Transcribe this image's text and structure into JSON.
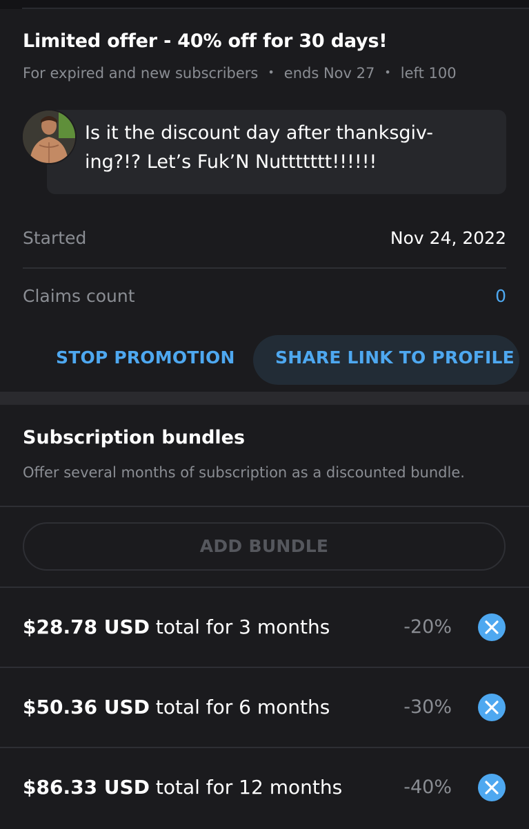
{
  "promotion": {
    "title": "Limited offer - 40% off for 30 days!",
    "audience": "For expired and new subscribers",
    "ends": "ends Nov 27",
    "left": "left 100",
    "message": "Is it the discount day after thanksgiv-ing?!? Let’s Fuk’N Nuttttttt!!!!!!",
    "started_label": "Started",
    "started_value": "Nov 24, 2022",
    "claims_label": "Claims count",
    "claims_value": "0",
    "stop_label": "STOP PROMOTION",
    "share_label": "SHARE LINK TO PROFILE"
  },
  "bundles": {
    "title": "Subscription bundles",
    "subtitle": "Offer several months of subscription as a discounted bundle.",
    "add_label": "ADD BUNDLE",
    "items": [
      {
        "amount": "$28.78 USD",
        "term": " total for 3 months",
        "discount": "-20%"
      },
      {
        "amount": "$50.36 USD",
        "term": " total for 6 months",
        "discount": "-30%"
      },
      {
        "amount": "$86.33 USD",
        "term": " total for 12 months",
        "discount": "-40%"
      }
    ]
  },
  "colors": {
    "accent": "#4ea8f0",
    "background": "#1b1b1e",
    "muted_text": "#8a8d93"
  },
  "icons": {
    "avatar": "avatar-photo",
    "remove": "close-circle-icon"
  }
}
